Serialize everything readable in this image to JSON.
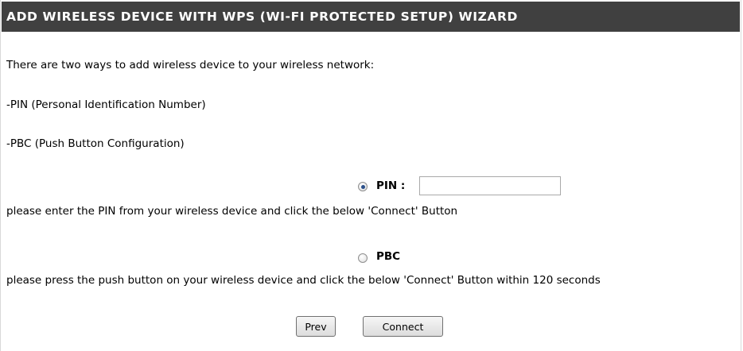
{
  "header": {
    "title": "ADD WIRELESS DEVICE WITH WPS (WI-FI PROTECTED SETUP) WIZARD"
  },
  "intro": {
    "text": "There are two ways to add wireless device to your wireless network:",
    "pin_method": "-PIN (Personal Identification Number)",
    "pbc_method": "-PBC (Push Button Configuration)"
  },
  "pin_option": {
    "label": "PIN :",
    "selected": true,
    "input_value": "",
    "instructions": "please enter the PIN from your wireless device and click the below 'Connect' Button"
  },
  "pbc_option": {
    "label": "PBC",
    "selected": false,
    "instructions": "please press the push button on your wireless device and click the below 'Connect' Button within 120 seconds"
  },
  "buttons": {
    "prev_label": "Prev",
    "connect_label": "Connect"
  },
  "colors": {
    "header_bg": "#404040",
    "header_text": "#ffffff",
    "radio_dot": "#2a4f8a"
  }
}
